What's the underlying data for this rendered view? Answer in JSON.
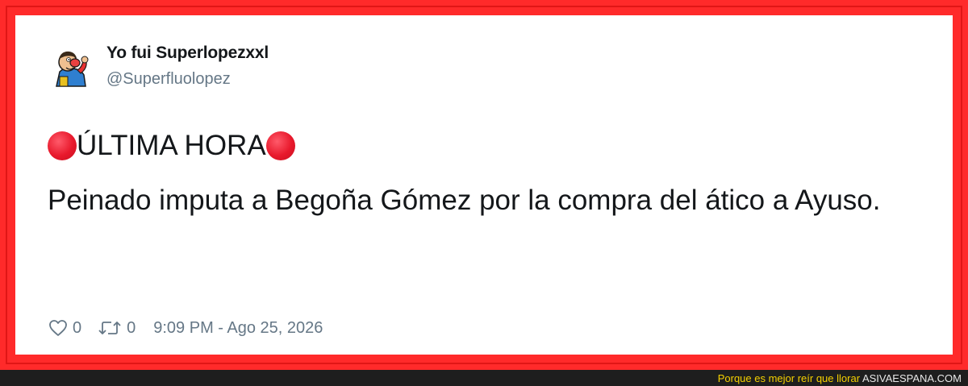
{
  "tweet": {
    "display_name": "Yo fui Superlopezxxl",
    "handle": "@Superfluolopez",
    "headline": "ÚLTIMA HORA",
    "body": "Peinado imputa a Begoña Gómez por la compra del ático a Ayuso.",
    "likes": "0",
    "retweets": "0",
    "timestamp": "9:09 PM - Ago 25, 2026",
    "avatar_icon": "cartoon-avatar-icon",
    "headline_icon": "red-circle-emoji-icon"
  },
  "footer": {
    "slogan": "Porque es mejor reír que llorar",
    "site": "ASIVAESPANA.COM"
  },
  "colors": {
    "frame": "#ff2a2a",
    "text": "#14171a",
    "muted": "#657786",
    "footer_bg": "#1e1e1e",
    "footer_slogan": "#f5d000"
  }
}
